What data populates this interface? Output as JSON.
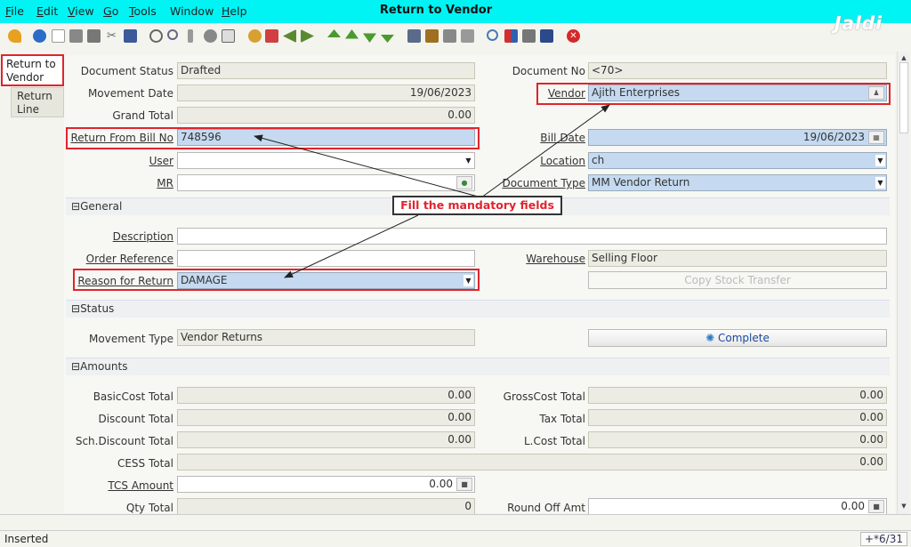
{
  "menu": {
    "items": [
      {
        "label": "File",
        "underline": "F",
        "rest": "ile"
      },
      {
        "label": "Edit",
        "underline": "E",
        "rest": "dit"
      },
      {
        "label": "View",
        "underline": "V",
        "rest": "iew"
      },
      {
        "label": "Go",
        "underline": "G",
        "rest": "o"
      },
      {
        "label": "Tools",
        "underline": "T",
        "rest": "ools"
      },
      {
        "label": "Window",
        "underline": "",
        "rest": "Window"
      },
      {
        "label": "Help",
        "underline": "H",
        "rest": "elp"
      }
    ]
  },
  "window_title": "Return to Vendor",
  "logo_text": "Jaldi",
  "toolbar_icons": [
    "undo-icon",
    "help-icon",
    "new-icon",
    "copy-icon",
    "delete-icon",
    "delete-selection-icon",
    "save-icon",
    "refresh-icon",
    "find-icon",
    "attachment-icon",
    "chat-icon",
    "grid-toggle-icon",
    "history-icon",
    "home-icon",
    "previous-icon",
    "next-icon",
    "first-record-icon",
    "previous-record-icon",
    "next-record-icon",
    "last-record-icon",
    "report-icon",
    "archive-icon",
    "print-preview-icon",
    "print-icon",
    "zoom-across-icon",
    "workflow-icon",
    "product-info-icon",
    "request-icon",
    "exit-icon"
  ],
  "tabs": {
    "return_to_vendor": "Return to Vendor",
    "return_line": "Return Line"
  },
  "fields": {
    "document_status": {
      "label": "Document Status",
      "value": "Drafted"
    },
    "document_no": {
      "label": "Document No",
      "value": "<70>"
    },
    "movement_date": {
      "label": "Movement Date",
      "value": "19/06/2023"
    },
    "vendor": {
      "label": "Vendor",
      "value": "Ajith Enterprises"
    },
    "grand_total": {
      "label": "Grand Total",
      "value": "0.00"
    },
    "return_from_bill_no": {
      "label": "Return From Bill No",
      "value": "748596"
    },
    "bill_date": {
      "label": "Bill Date",
      "value": "19/06/2023"
    },
    "user": {
      "label": "User",
      "value": ""
    },
    "location": {
      "label": "Location",
      "value": "ch"
    },
    "mr": {
      "label": "MR",
      "value": ""
    },
    "document_type": {
      "label": "Document Type",
      "value": "MM Vendor Return"
    },
    "description": {
      "label": "Description",
      "value": ""
    },
    "order_reference": {
      "label": "Order Reference",
      "value": ""
    },
    "warehouse": {
      "label": "Warehouse",
      "value": "Selling Floor"
    },
    "reason_for_return": {
      "label": "Reason for Return",
      "value": "DAMAGE"
    },
    "movement_type": {
      "label": "Movement Type",
      "value": "Vendor Returns"
    },
    "basiccost_total": {
      "label": "BasicCost Total",
      "value": "0.00"
    },
    "grosscost_total": {
      "label": "GrossCost Total",
      "value": "0.00"
    },
    "discount_total": {
      "label": "Discount Total",
      "value": "0.00"
    },
    "tax_total": {
      "label": "Tax Total",
      "value": "0.00"
    },
    "sch_discount_total": {
      "label": "Sch.Discount Total",
      "value": "0.00"
    },
    "lcost_total": {
      "label": "L.Cost Total",
      "value": "0.00"
    },
    "cess_total": {
      "label": "CESS Total",
      "value": "0.00"
    },
    "tcs_amount": {
      "label": "TCS Amount",
      "value": "0.00"
    },
    "qty_total": {
      "label": "Qty Total",
      "value": "0"
    },
    "round_off_amt": {
      "label": "Round Off Amt",
      "value": "0.00"
    }
  },
  "sections": {
    "general": "General",
    "status": "Status",
    "amounts": "Amounts"
  },
  "buttons": {
    "copy_stock_transfer": "Copy Stock Transfer",
    "complete": "Complete"
  },
  "annotation": {
    "callout": "Fill the mandatory fields",
    "color": "#e0242c"
  },
  "status_bar": {
    "text": "Inserted",
    "record": "+*6/31"
  }
}
